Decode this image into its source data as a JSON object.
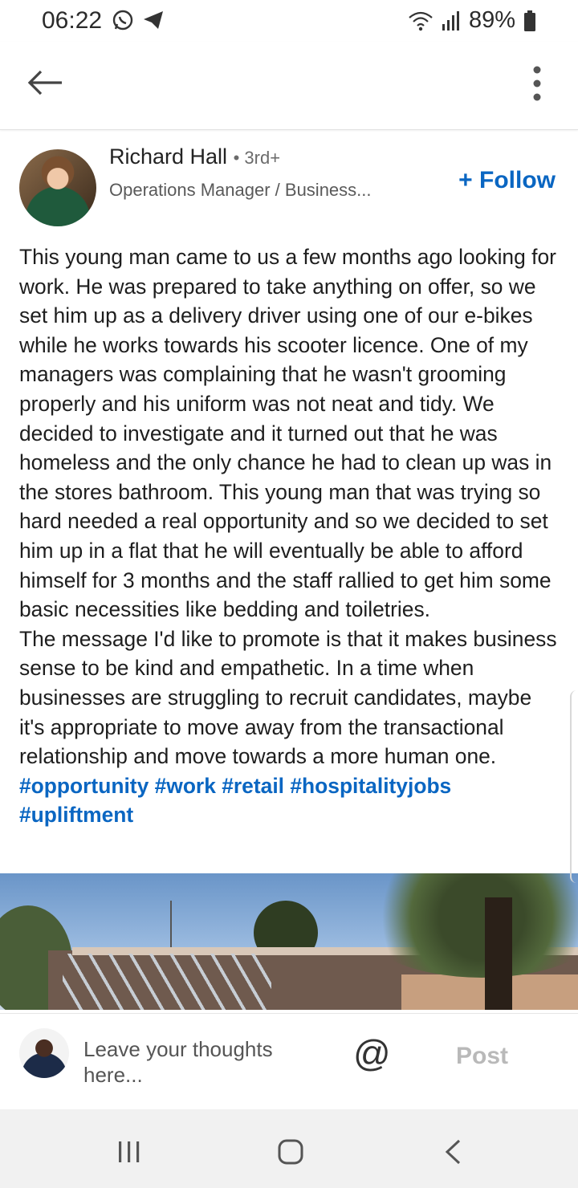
{
  "status_bar": {
    "time": "06:22",
    "battery": "89%",
    "icons": [
      "whatsapp-icon",
      "telegram-icon",
      "wifi-icon",
      "signal-icon",
      "battery-icon"
    ]
  },
  "app_bar": {
    "icons": [
      "back-arrow-icon",
      "more-vert-icon"
    ]
  },
  "author": {
    "name": "Richard Hall",
    "degree": "3rd+",
    "headline": "Operations Manager / Business...",
    "follow_label": "+ Follow"
  },
  "post": {
    "paragraph_1": "This young man came to us a few months ago looking for work. He was prepared to take anything on offer, so we set him up as a delivery driver using one of our e-bikes while he works towards his scooter licence. One of my managers was complaining that he wasn't grooming properly and his uniform was not neat and tidy. We decided to investigate and it turned out that he was homeless and the only chance he had to clean up was in the stores bathroom. This young man that was trying so hard needed a real opportunity and so we decided to set him up in a flat that he will eventually be able to afford himself for 3 months and the staff rallied to get him some basic necessities like bedding and toiletries.",
    "paragraph_2": "The message I'd like to promote is that it makes business sense to be kind and empathetic. In a time when businesses are struggling to recruit candidates, maybe it's appropriate to move away from the transactional relationship and move towards a more human one.",
    "hashtags": [
      "#opportunity",
      "#work",
      "#retail",
      "#hospitalityjobs",
      "#upliftment"
    ]
  },
  "comment_bar": {
    "placeholder": "Leave your thoughts here...",
    "mention_symbol": "@",
    "post_label": "Post"
  },
  "nav_bar": {
    "icons": [
      "recent-apps-icon",
      "home-icon",
      "back-icon"
    ]
  },
  "colors": {
    "accent": "#0a66c2",
    "disabled": "#b9b9b9"
  }
}
